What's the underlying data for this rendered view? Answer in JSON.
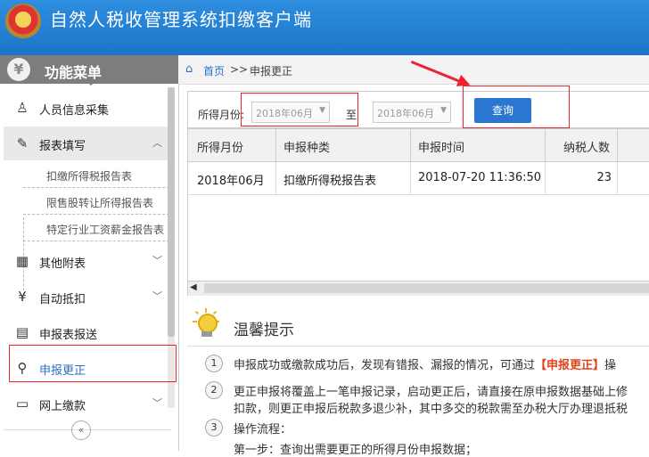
{
  "app": {
    "title": "自然人税收管理系统扣缴客户端"
  },
  "sidebar": {
    "header": {
      "logo_glyph": "¥",
      "title": "功能菜单"
    },
    "items": [
      {
        "label": "人员信息采集",
        "icon": "person-icon",
        "glyph": "♙"
      },
      {
        "label": "报表填写",
        "icon": "edit-icon",
        "glyph": "✎",
        "expanded": true
      },
      {
        "label": "其他附表",
        "icon": "grid-icon",
        "glyph": "▦"
      },
      {
        "label": "自动抵扣",
        "icon": "coin-icon",
        "glyph": "¥"
      },
      {
        "label": "申报表报送",
        "icon": "document-send-icon",
        "glyph": "▤"
      },
      {
        "label": "申报更正",
        "icon": "search-icon",
        "glyph": "⚲",
        "active": true
      },
      {
        "label": "网上缴款",
        "icon": "payment-icon",
        "glyph": "▭"
      }
    ],
    "sub_items": [
      {
        "label": "扣缴所得税报告表"
      },
      {
        "label": "限售股转让所得报告表"
      },
      {
        "label": "特定行业工资薪金报告表"
      }
    ],
    "collapse_glyph": "«"
  },
  "breadcrumb": {
    "home": "首页",
    "separator": ">>",
    "current": "申报更正"
  },
  "search": {
    "label": "所得月份:",
    "from": "2018年06月",
    "to_label": "至",
    "to": "2018年06月",
    "button": "查询"
  },
  "table": {
    "columns": [
      "所得月份",
      "申报种类",
      "申报时间",
      "纳税人数"
    ],
    "rows": [
      [
        "2018年06月",
        "扣缴所得税报告表",
        "2018-07-20 11:36:50",
        "23"
      ]
    ]
  },
  "tips": {
    "title": "温馨提示",
    "items": [
      {
        "num": "1",
        "text_before": "申报成功或缴款成功后，发现有错报、漏报的情况，可通过",
        "highlight": "【申报更正】",
        "text_after": "操"
      },
      {
        "num": "2",
        "line1": "更正申报将覆盖上一笔申报记录，启动更正后，请直接在原申报数据基础上修",
        "line2": "扣款，则更正申报后税款多退少补，其中多交的税款需至办税大厅办理退抵税"
      },
      {
        "num": "3",
        "line1": "操作流程：",
        "line2": "第一步：查询出需要更正的所得月份申报数据；"
      }
    ]
  },
  "colors": {
    "header": "#1b74c8",
    "accent": "#2b76d0",
    "highlight": "#e0441c",
    "annotation": "#e23"
  }
}
